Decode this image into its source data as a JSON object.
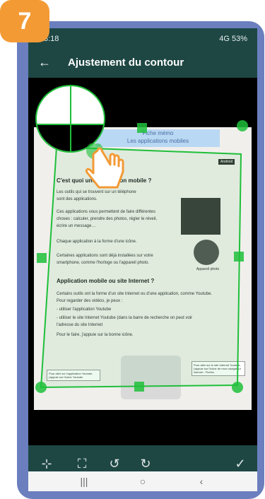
{
  "badge": {
    "step": "7"
  },
  "status_bar": {
    "time": "3:18",
    "signal": "4G",
    "battery": "53%"
  },
  "app_bar": {
    "back_icon": "arrow-left-icon",
    "title": "Ajustement du contour"
  },
  "document": {
    "header_title": "Fiche mémo",
    "header_subtitle": "Les applications mobiles",
    "badge": "Android",
    "q1_title": "C'est quoi une application mobile ?",
    "q1_lines": [
      "Les outils qui se trouvent sur un téléphone",
      "sont des applications.",
      "Ces applications vous permettent de faire différentes",
      "choses : calculer, prendre des photos, régler le réveil,",
      "écrire un message…",
      "Chaque application à la forme d'une icône.",
      "Certaines applications sont déjà installées sur votre",
      "smartphone, comme l'horloge ou l'appareil photo."
    ],
    "camera_label": "Appareil photo",
    "q2_title": "Application mobile ou site Internet ?",
    "q2_lines": [
      "Certains outils ont la forme d'un site Internet ou d'une application, comme Youtube.",
      "Pour regarder des vidéos, je peux :",
      "- utiliser l'application Youtube",
      "- utiliser le site Internet Youtube (dans la barre de recherche on peut voir",
      "  l'adresse du site Internet",
      "Pour le faire, j'appuie sur la bonne icône."
    ],
    "note_left": "Pour aller sur l'application Youtube, j'appuie sur l'icône Youtube",
    "note_right": "Pour aller sur le site Internet Youtube, j'appuie sur l'icône de mon navigateur internet : Firefox"
  },
  "toolbar": {
    "items": [
      {
        "icon": "collapse-icon",
        "glyph": "⊹"
      },
      {
        "icon": "expand-icon",
        "glyph": "⛶"
      },
      {
        "icon": "rotate-left-icon",
        "glyph": "↺"
      },
      {
        "icon": "rotate-right-icon",
        "glyph": "↻"
      },
      {
        "icon": "check-icon",
        "glyph": "✓"
      }
    ]
  },
  "nav": {
    "recents": "|||",
    "home": "○",
    "back": "‹"
  },
  "colors": {
    "app_bar": "#1e4744",
    "accent": "#1fbf3a",
    "badge": "#f39a35",
    "frame": "#6b7fbf"
  }
}
